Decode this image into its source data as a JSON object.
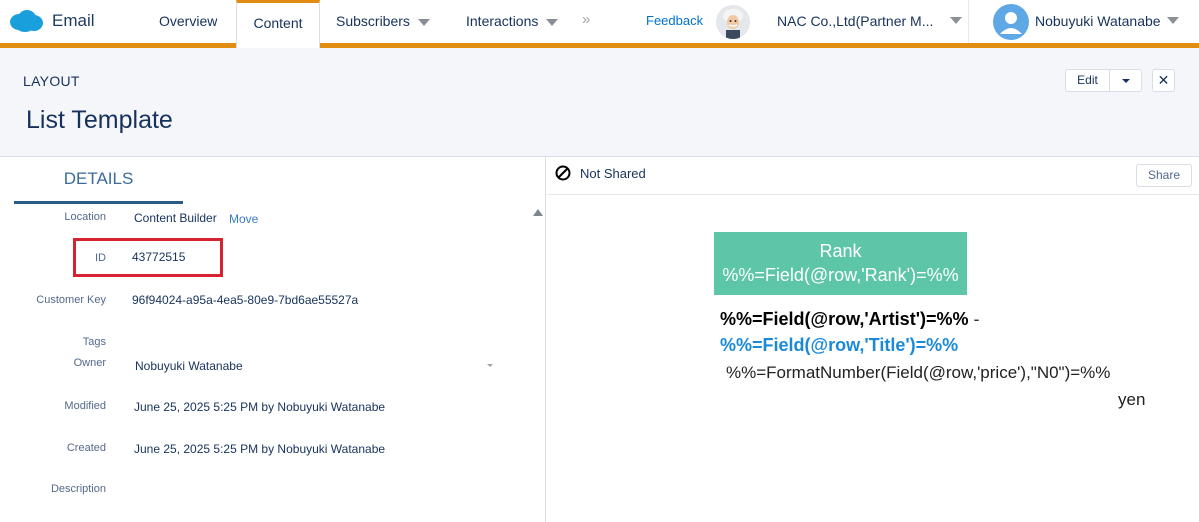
{
  "nav": {
    "app_name": "Email",
    "tabs": [
      {
        "label": "Overview"
      },
      {
        "label": "Content"
      },
      {
        "label": "Subscribers"
      },
      {
        "label": "Interactions"
      }
    ],
    "more_icon": "»",
    "feedback": "Feedback",
    "org": "NAC Co.,Ltd(Partner M...",
    "user": "Nobuyuki Watanabe",
    "accent_color": "#e08d12"
  },
  "header": {
    "eyebrow": "LAYOUT",
    "title": "List Template",
    "edit_label": "Edit",
    "close_icon": "✕"
  },
  "details": {
    "tab_label": "DETAILS",
    "location_label": "Location",
    "location_value": "Content Builder",
    "move_link": "Move",
    "id_label": "ID",
    "id_value": "43772515",
    "customer_key_label": "Customer Key",
    "customer_key_value": "96f94024-a95a-4ea5-80e9-7bd6ae55527a",
    "tags_label": "Tags",
    "owner_label": "Owner",
    "owner_value": "Nobuyuki Watanabe",
    "modified_label": "Modified",
    "modified_value": "June 25, 2025 5:25 PM by Nobuyuki Watanabe",
    "created_label": "Created",
    "created_value": "June 25, 2025 5:25 PM by Nobuyuki Watanabe",
    "description_label": "Description"
  },
  "preview": {
    "share_status": "Not Shared",
    "share_button": "Share",
    "rank_heading": "Rank",
    "rank_field": "%%=Field(@row,'Rank')=%%",
    "artist_field": "%%=Field(@row,'Artist')=%%",
    "separator": " -",
    "title_field": "%%=Field(@row,'Title')=%%",
    "price_field": "%%=FormatNumber(Field(@row,'price'),\"N0\")=%%",
    "yen": "yen",
    "rank_color": "#5ec6a8",
    "title_color": "#1a8ad8"
  }
}
